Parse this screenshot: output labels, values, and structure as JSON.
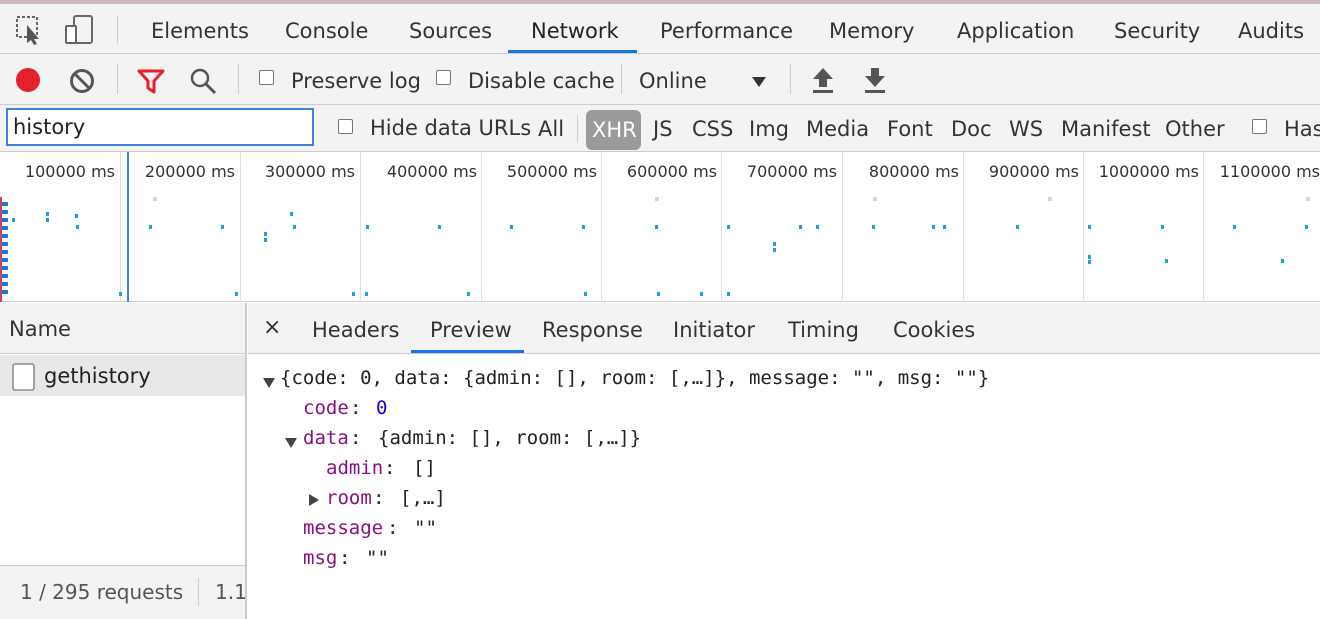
{
  "tabs": [
    "Elements",
    "Console",
    "Sources",
    "Network",
    "Performance",
    "Memory",
    "Application",
    "Security",
    "Audits"
  ],
  "active_tab": "Network",
  "toolbar": {
    "preserve_log": "Preserve log",
    "disable_cache": "Disable cache",
    "throttle": "Online",
    "record_color": "#e8202a",
    "filter_color": "#e8202a"
  },
  "filter": {
    "value": "history",
    "hide_data_urls": "Hide data URLs",
    "types": [
      "All",
      "XHR",
      "JS",
      "CSS",
      "Img",
      "Media",
      "Font",
      "Doc",
      "WS",
      "Manifest",
      "Other"
    ],
    "active_type": "XHR",
    "has_blocked": "Has"
  },
  "overview": {
    "ticks": [
      "100000 ms",
      "200000 ms",
      "300000 ms",
      "400000 ms",
      "500000 ms",
      "600000 ms",
      "700000 ms",
      "800000 ms",
      "900000 ms",
      "1000000 ms",
      "1100000 ms"
    ]
  },
  "requests": {
    "header": "Name",
    "rows": [
      "gethistory"
    ],
    "status": "1 / 295 requests",
    "status_extra": "1.1"
  },
  "detail": {
    "close": "×",
    "tabs": [
      "Headers",
      "Preview",
      "Response",
      "Initiator",
      "Timing",
      "Cookies"
    ],
    "active_tab": "Preview",
    "preview": {
      "root": "{code: 0, data: {admin: [], room: [,…]}, message: \"\", msg: \"\"}",
      "code_key": "code",
      "code_val": "0",
      "data_key": "data",
      "data_val": "{admin: [], room: [,…]}",
      "admin_key": "admin",
      "admin_val": "[]",
      "room_key": "room",
      "room_val": "[,…]",
      "message_key": "message",
      "message_val": "\"\"",
      "msg_key": "msg",
      "msg_val": "\"\""
    }
  }
}
